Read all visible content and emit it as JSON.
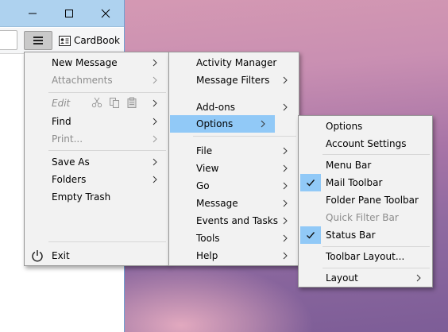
{
  "toolbar": {
    "cardbook_label": "CardBook"
  },
  "app_menu": {
    "items": [
      {
        "label": "New Message",
        "enabled": true,
        "submenu": true
      },
      {
        "label": "Attachments",
        "enabled": false,
        "submenu": true
      },
      {
        "label": "Edit",
        "enabled": false,
        "submenu": true
      },
      {
        "label": "Find",
        "enabled": true,
        "submenu": true
      },
      {
        "label": "Print...",
        "enabled": false,
        "submenu": true
      },
      {
        "label": "Save As",
        "enabled": true,
        "submenu": true
      },
      {
        "label": "Folders",
        "enabled": true,
        "submenu": true
      },
      {
        "label": "Empty Trash",
        "enabled": true,
        "submenu": false
      },
      {
        "label": "Exit",
        "enabled": true,
        "submenu": false
      }
    ]
  },
  "submenu": {
    "items": [
      {
        "label": "Activity Manager",
        "submenu": false
      },
      {
        "label": "Message Filters",
        "submenu": true
      },
      {
        "label": "Add-ons",
        "submenu": true
      },
      {
        "label": "Options",
        "submenu": true,
        "highlighted": true
      },
      {
        "label": "File",
        "submenu": true
      },
      {
        "label": "View",
        "submenu": true
      },
      {
        "label": "Go",
        "submenu": true
      },
      {
        "label": "Message",
        "submenu": true
      },
      {
        "label": "Events and Tasks",
        "submenu": true
      },
      {
        "label": "Tools",
        "submenu": true
      },
      {
        "label": "Help",
        "submenu": true
      }
    ]
  },
  "options_menu": {
    "items": [
      {
        "label": "Options",
        "checked": false
      },
      {
        "label": "Account Settings",
        "checked": false
      },
      {
        "label": "Menu Bar",
        "checked": false
      },
      {
        "label": "Mail Toolbar",
        "checked": true
      },
      {
        "label": "Folder Pane Toolbar",
        "checked": false
      },
      {
        "label": "Quick Filter Bar",
        "checked": false,
        "enabled": false
      },
      {
        "label": "Status Bar",
        "checked": true
      },
      {
        "label": "Toolbar Layout...",
        "checked": false
      },
      {
        "label": "Layout",
        "checked": false,
        "submenu": true
      }
    ]
  },
  "colors": {
    "highlight": "#91c9f7",
    "titlebar": "#aed2ef",
    "menu_bg": "#f2f2f2",
    "disabled_text": "#8c8c8c"
  }
}
